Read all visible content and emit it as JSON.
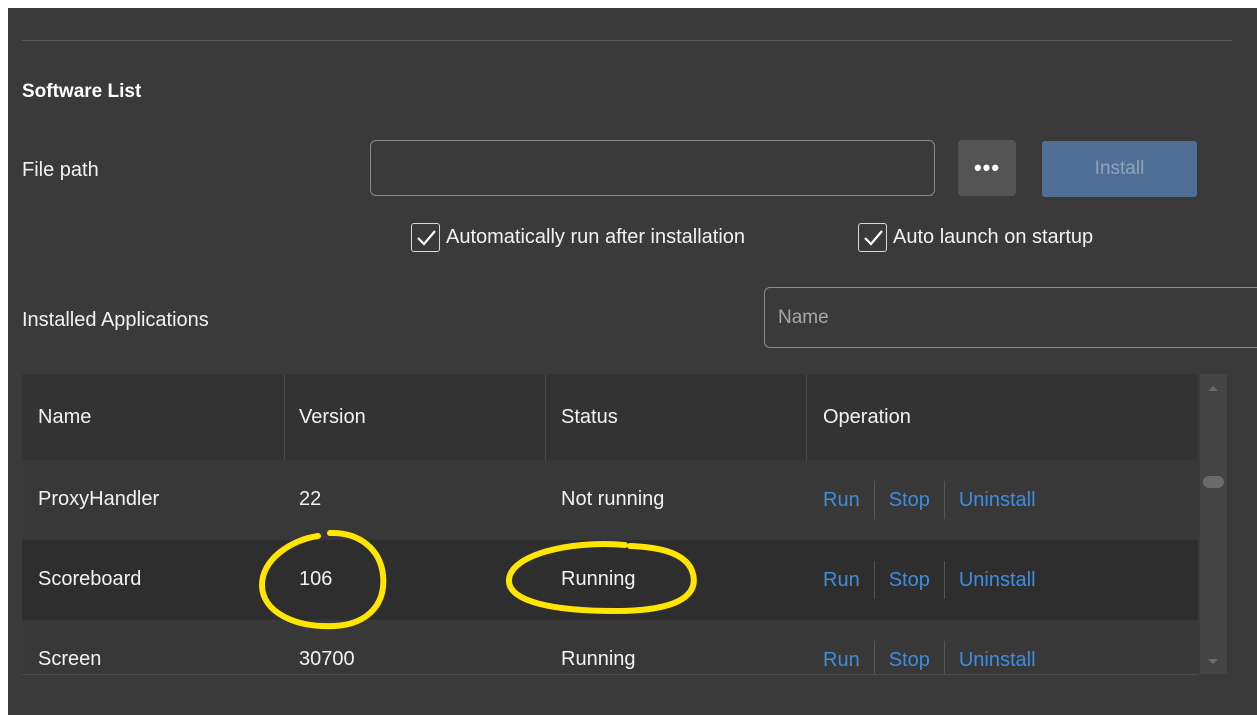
{
  "section": {
    "title": "Software List"
  },
  "install_form": {
    "file_path_label": "File path",
    "file_path_value": "",
    "browse_label": "•••",
    "install_label": "Install",
    "auto_run": {
      "label": "Automatically run after installation",
      "checked": true
    },
    "auto_launch": {
      "label": "Auto launch on startup",
      "checked": true
    }
  },
  "installed": {
    "label": "Installed Applications",
    "search_placeholder": "Name"
  },
  "table": {
    "headers": {
      "name": "Name",
      "version": "Version",
      "status": "Status",
      "operation": "Operation"
    },
    "rows": [
      {
        "name": "ProxyHandler",
        "version": "22",
        "status": "Not running"
      },
      {
        "name": "Scoreboard",
        "version": "106",
        "status": "Running"
      },
      {
        "name": "Screen",
        "version": "30700",
        "status": "Running"
      }
    ],
    "actions": {
      "run": "Run",
      "stop": "Stop",
      "uninstall": "Uninstall"
    }
  },
  "colors": {
    "background": "#3a3a3a",
    "link": "#3c8de0",
    "install_button": "#4f6f96",
    "annotation": "#ffe600"
  }
}
